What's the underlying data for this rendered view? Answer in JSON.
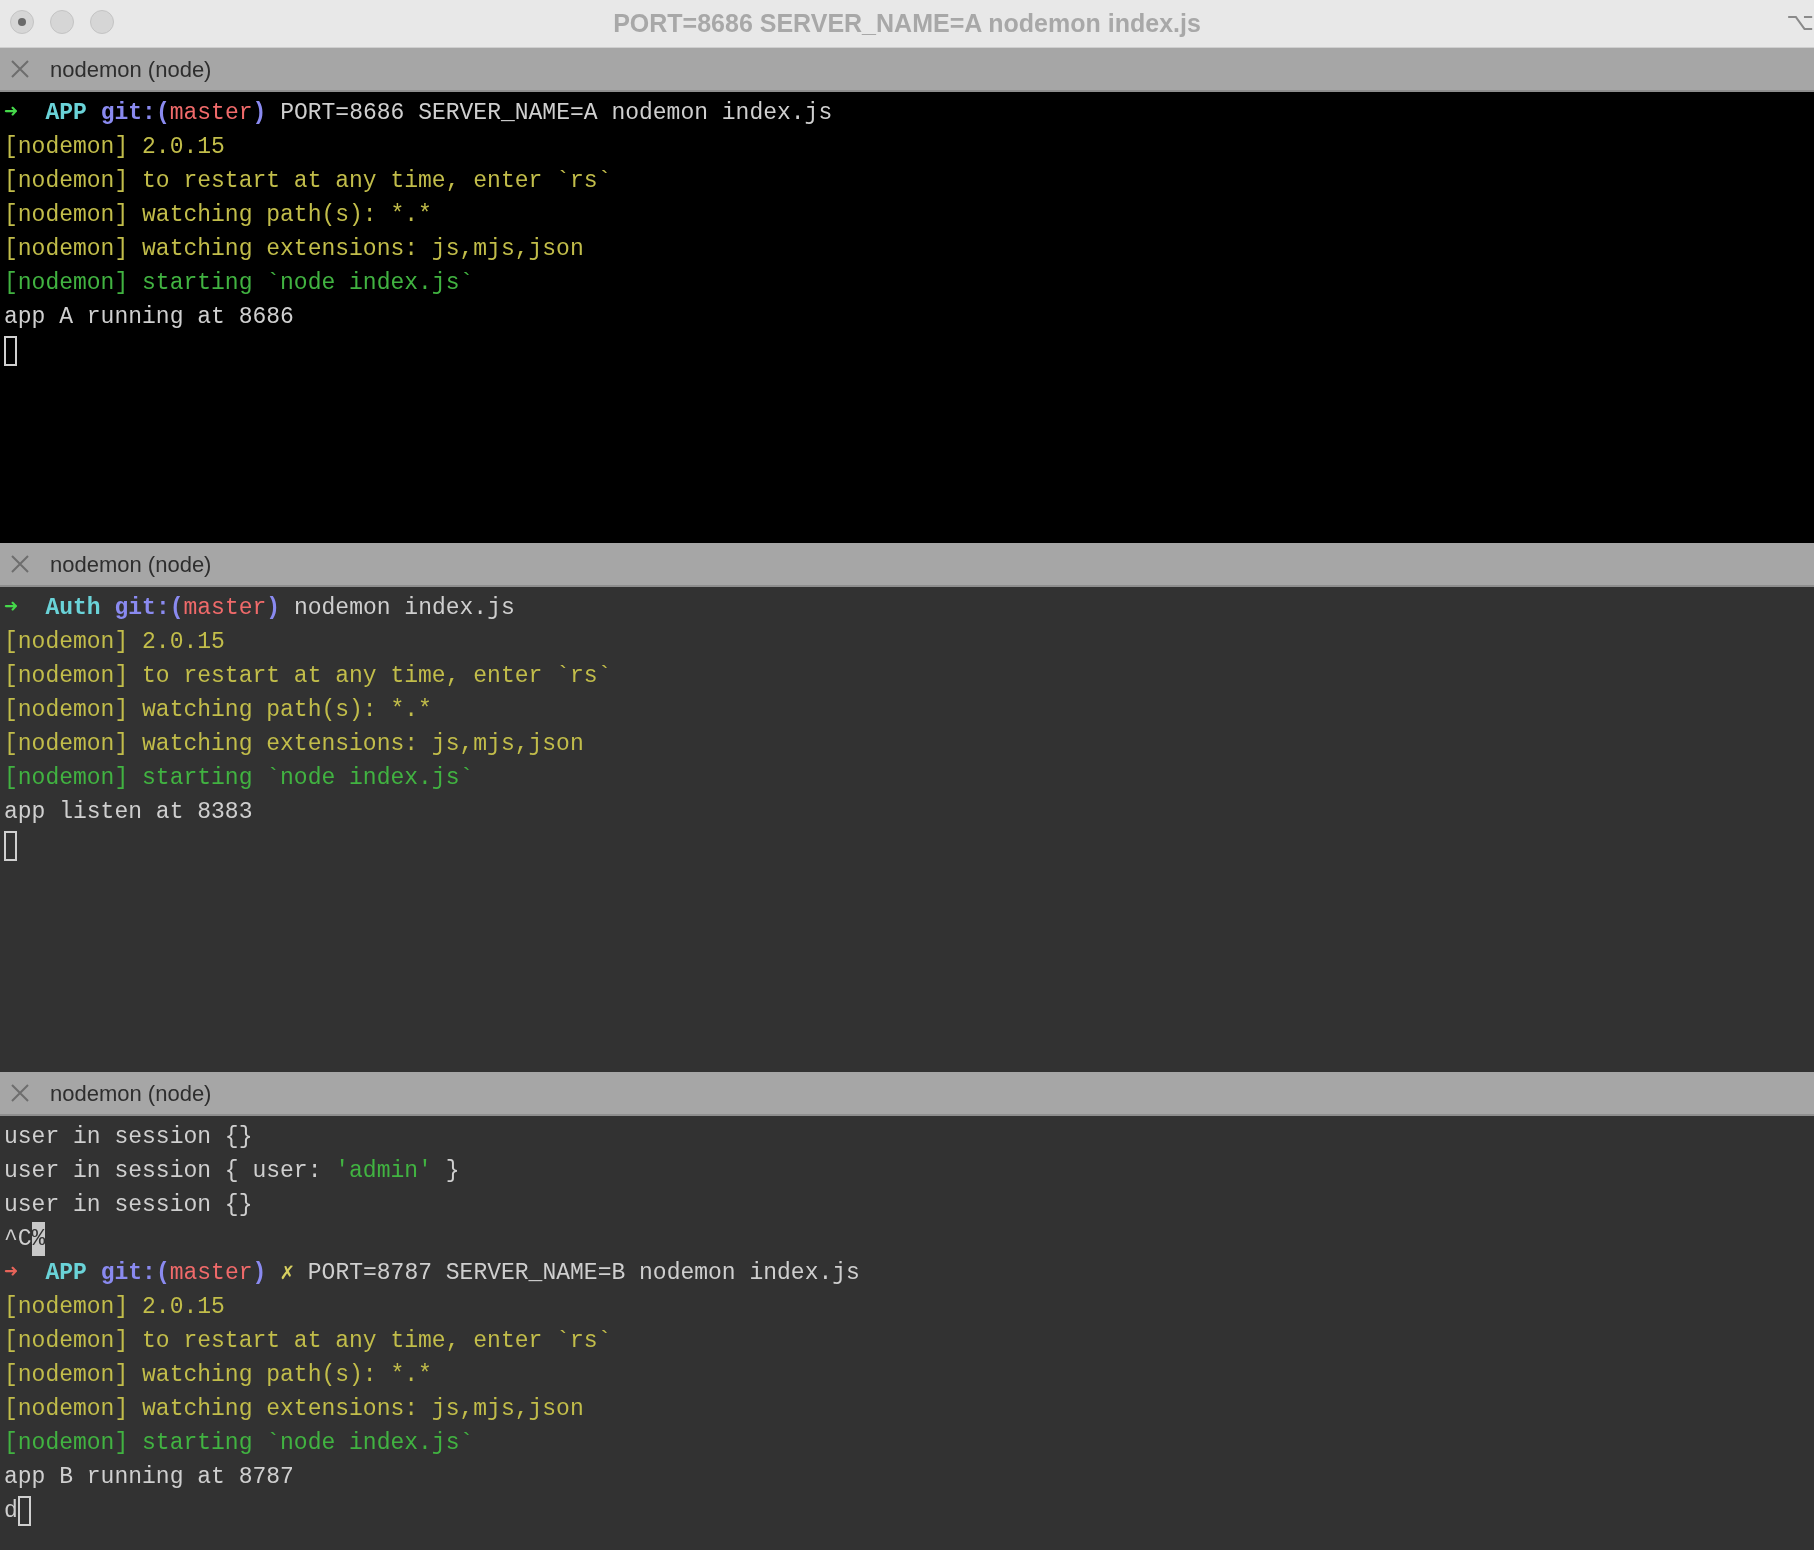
{
  "window": {
    "title": "PORT=8686 SERVER_NAME=A nodemon index.js",
    "shortcut_hint": "⌥"
  },
  "panes": [
    {
      "tab_title": "nodemon (node)",
      "focused": true,
      "lines": [
        {
          "segments": [
            {
              "text": "➜  ",
              "kind": "arrow-ok"
            },
            {
              "text": "APP ",
              "kind": "dir"
            },
            {
              "text": "git:(",
              "kind": "git"
            },
            {
              "text": "master",
              "kind": "branch"
            },
            {
              "text": ")",
              "kind": "git"
            },
            {
              "text": " PORT=8686 SERVER_NAME=A nodemon index.js",
              "kind": "plain"
            }
          ]
        },
        {
          "segments": [
            {
              "text": "[nodemon] 2.0.15",
              "kind": "info"
            }
          ]
        },
        {
          "segments": [
            {
              "text": "[nodemon] to restart at any time, enter `rs`",
              "kind": "info"
            }
          ]
        },
        {
          "segments": [
            {
              "text": "[nodemon] watching path(s): *.*",
              "kind": "info"
            }
          ]
        },
        {
          "segments": [
            {
              "text": "[nodemon] watching extensions: js,mjs,json",
              "kind": "info"
            }
          ]
        },
        {
          "segments": [
            {
              "text": "[nodemon] starting `node index.js`",
              "kind": "start"
            }
          ]
        },
        {
          "segments": [
            {
              "text": "app A running at 8686",
              "kind": "plain"
            }
          ]
        },
        {
          "cursor": true
        }
      ]
    },
    {
      "tab_title": "nodemon (node)",
      "focused": false,
      "lines": [
        {
          "segments": [
            {
              "text": "➜  ",
              "kind": "arrow-ok"
            },
            {
              "text": "Auth ",
              "kind": "dir"
            },
            {
              "text": "git:(",
              "kind": "git"
            },
            {
              "text": "master",
              "kind": "branch"
            },
            {
              "text": ")",
              "kind": "git"
            },
            {
              "text": " nodemon index.js",
              "kind": "plain"
            }
          ]
        },
        {
          "segments": [
            {
              "text": "[nodemon] 2.0.15",
              "kind": "info"
            }
          ]
        },
        {
          "segments": [
            {
              "text": "[nodemon] to restart at any time, enter `rs`",
              "kind": "info"
            }
          ]
        },
        {
          "segments": [
            {
              "text": "[nodemon] watching path(s): *.*",
              "kind": "info"
            }
          ]
        },
        {
          "segments": [
            {
              "text": "[nodemon] watching extensions: js,mjs,json",
              "kind": "info"
            }
          ]
        },
        {
          "segments": [
            {
              "text": "[nodemon] starting `node index.js`",
              "kind": "start"
            }
          ]
        },
        {
          "segments": [
            {
              "text": "app listen at 8383",
              "kind": "plain"
            }
          ]
        },
        {
          "cursor": true
        }
      ]
    },
    {
      "tab_title": "nodemon (node)",
      "focused": false,
      "lines": [
        {
          "segments": [
            {
              "text": "user in session {}",
              "kind": "plain"
            }
          ]
        },
        {
          "segments": [
            {
              "text": "user in session { user: ",
              "kind": "plain"
            },
            {
              "text": "'admin'",
              "kind": "string"
            },
            {
              "text": " }",
              "kind": "plain"
            }
          ]
        },
        {
          "segments": [
            {
              "text": "user in session {}",
              "kind": "plain"
            }
          ]
        },
        {
          "segments": [
            {
              "text": "^C",
              "kind": "plain"
            },
            {
              "text": "%",
              "kind": "inverse"
            }
          ]
        },
        {
          "segments": [
            {
              "text": "➜  ",
              "kind": "arrow-error"
            },
            {
              "text": "APP ",
              "kind": "dir"
            },
            {
              "text": "git:(",
              "kind": "git"
            },
            {
              "text": "master",
              "kind": "branch"
            },
            {
              "text": ")",
              "kind": "git"
            },
            {
              "text": " ✗",
              "kind": "dirty"
            },
            {
              "text": " PORT=8787 SERVER_NAME=B nodemon index.js",
              "kind": "plain"
            }
          ]
        },
        {
          "segments": [
            {
              "text": "[nodemon] 2.0.15",
              "kind": "info"
            }
          ]
        },
        {
          "segments": [
            {
              "text": "[nodemon] to restart at any time, enter `rs`",
              "kind": "info"
            }
          ]
        },
        {
          "segments": [
            {
              "text": "[nodemon] watching path(s): *.*",
              "kind": "info"
            }
          ]
        },
        {
          "segments": [
            {
              "text": "[nodemon] watching extensions: js,mjs,json",
              "kind": "info"
            }
          ]
        },
        {
          "segments": [
            {
              "text": "[nodemon] starting `node index.js`",
              "kind": "start"
            }
          ]
        },
        {
          "segments": [
            {
              "text": "app B running at 8787",
              "kind": "plain"
            }
          ]
        },
        {
          "segments": [
            {
              "text": "d",
              "kind": "plain"
            }
          ],
          "cursor": true
        }
      ]
    }
  ]
}
